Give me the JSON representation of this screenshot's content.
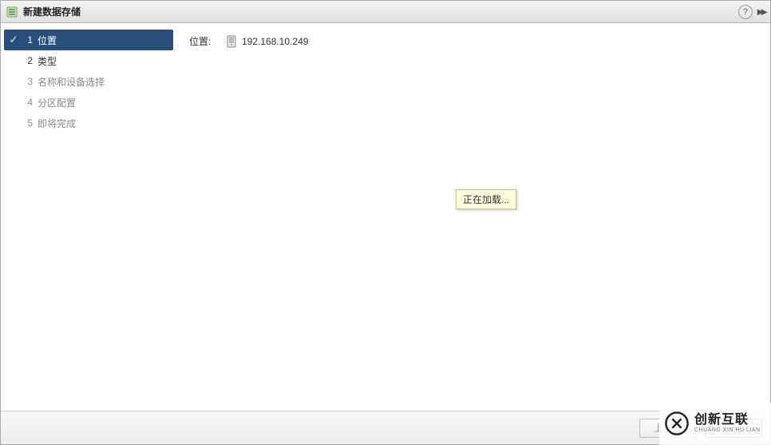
{
  "title": "新建数据存储",
  "help_glyph": "?",
  "expand_glyph": "▸▸",
  "steps": [
    {
      "num": "1",
      "label": "位置",
      "active": true,
      "checked": true,
      "disabled": false
    },
    {
      "num": "2",
      "label": "类型",
      "active": false,
      "checked": false,
      "disabled": false
    },
    {
      "num": "3",
      "label": "名称和设备选择",
      "active": false,
      "checked": false,
      "disabled": true
    },
    {
      "num": "4",
      "label": "分区配置",
      "active": false,
      "checked": false,
      "disabled": true
    },
    {
      "num": "5",
      "label": "即将完成",
      "active": false,
      "checked": false,
      "disabled": true
    }
  ],
  "content": {
    "location_label": "位置:",
    "location_value": "192.168.10.249",
    "loading_text": "正在加载..."
  },
  "footer": {
    "back_label": "上一步",
    "next_label": "下一步"
  },
  "watermark": {
    "main": "创新互联",
    "sub": "CHUANG XIN HU LIAN"
  }
}
